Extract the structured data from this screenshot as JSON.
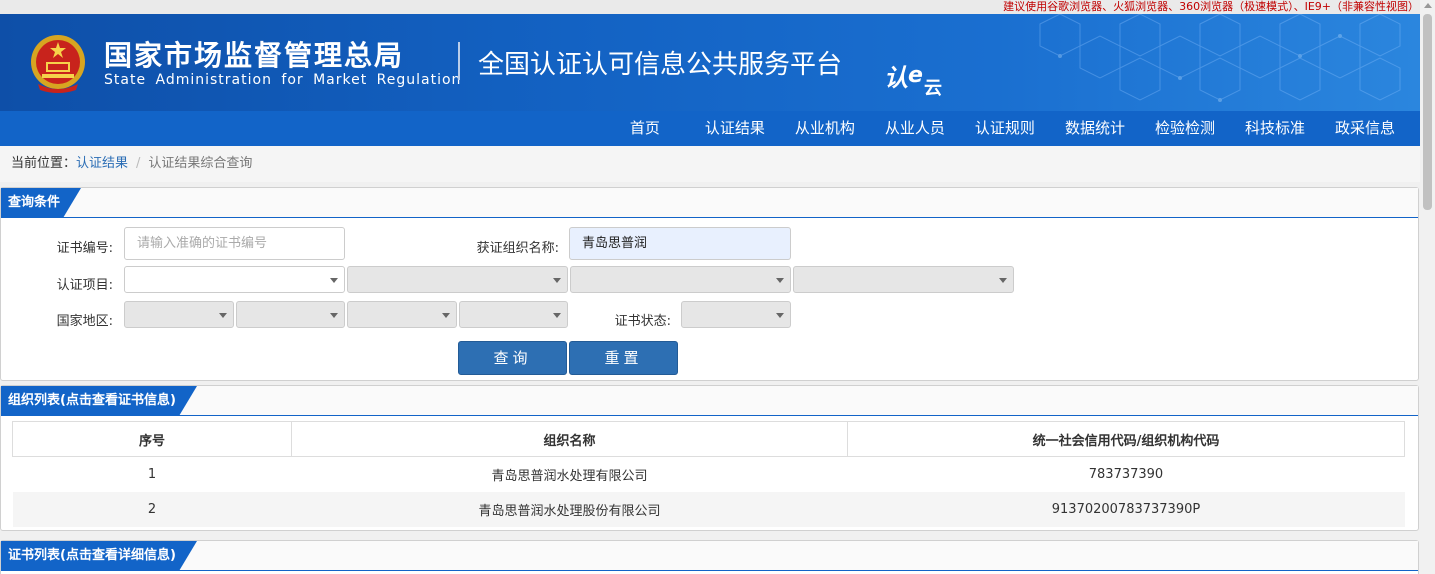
{
  "notice": "建议使用谷歌浏览器、火狐浏览器、360浏览器（极速模式）、IE9+（非兼容性视图）",
  "header": {
    "org_cn": "国家市场监督管理总局",
    "org_en": "State Administration  for  Market Regulation",
    "platform": "全国认证认可信息公共服务平台",
    "logo_text": "认e云"
  },
  "nav": [
    "首页",
    "认证结果",
    "从业机构",
    "从业人员",
    "认证规则",
    "数据统计",
    "检验检测",
    "科技标准",
    "政采信息"
  ],
  "breadcrumb": {
    "prefix": "当前位置：",
    "link": "认证结果",
    "separator": "/",
    "current": "认证结果综合查询"
  },
  "query": {
    "title": "查询条件",
    "cert_no_label": "证书编号:",
    "cert_no_placeholder": "请输入准确的证书编号",
    "org_name_label": "获证组织名称:",
    "org_name_value": "青岛思普润",
    "project_label": "认证项目:",
    "region_label": "国家地区:",
    "status_label": "证书状态:",
    "search_button": "查询",
    "reset_button": "重置"
  },
  "org_list": {
    "title": "组织列表(点击查看证书信息)",
    "columns": [
      "序号",
      "组织名称",
      "统一社会信用代码/组织机构代码"
    ],
    "rows": [
      [
        "1",
        "青岛思普润水处理有限公司",
        "783737390"
      ],
      [
        "2",
        "青岛思普润水处理股份有限公司",
        "91370200783737390P"
      ]
    ]
  },
  "cert_list": {
    "title": "证书列表(点击查看详细信息)"
  },
  "colors": {
    "primary": "#1264c8",
    "button": "#2d6fb3",
    "notice": "#c00000"
  }
}
